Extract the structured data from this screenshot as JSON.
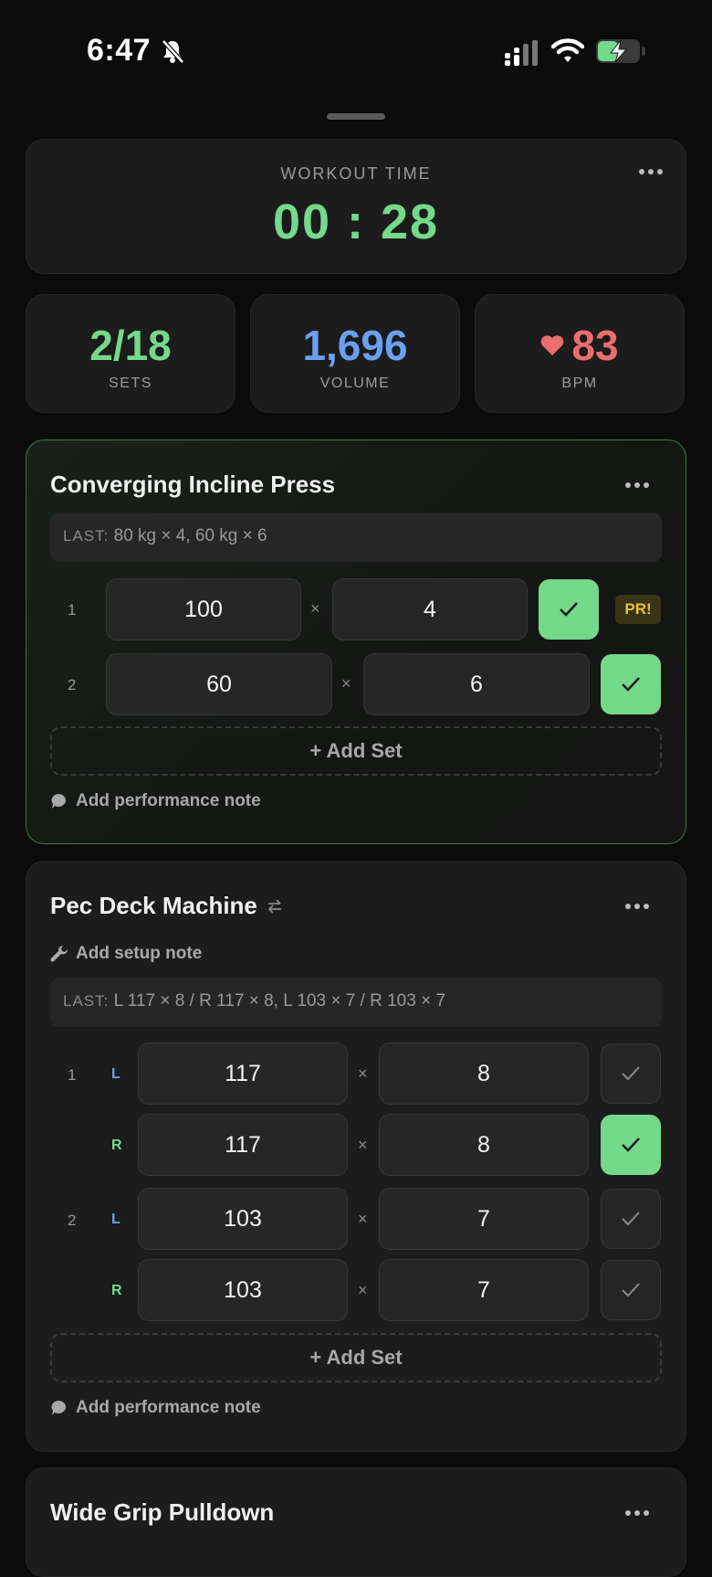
{
  "status_bar": {
    "time": "6:47"
  },
  "timer": {
    "label": "WORKOUT TIME",
    "value": "00 : 28"
  },
  "stats": {
    "sets": {
      "value": "2/18",
      "label": "SETS"
    },
    "volume": {
      "value": "1,696",
      "label": "VOLUME"
    },
    "bpm": {
      "value": "83",
      "label": "BPM"
    }
  },
  "colors": {
    "accent_green": "#74d98a",
    "volume_blue": "#6aa0f0",
    "bpm_red": "#ea6e6c",
    "pr_gold": "#e8c43a"
  },
  "exercises": [
    {
      "name": "Converging Incline Press",
      "last_label": "LAST:",
      "last_text": "80 kg × 4, 60 kg × 6",
      "sets": [
        {
          "num": "1",
          "weight": "100",
          "reps": "4",
          "done": true,
          "badge": "PR!"
        },
        {
          "num": "2",
          "weight": "60",
          "reps": "6",
          "done": true
        }
      ],
      "add_set": "+ Add Set",
      "note": "Add performance note"
    },
    {
      "name": "Pec Deck Machine",
      "setup_note": "Add setup note",
      "last_label": "LAST:",
      "last_text": "L 117 × 8 / R 117 × 8, L 103 × 7 / R 103 × 7",
      "sets": [
        {
          "num": "1",
          "side": "L",
          "weight": "117",
          "reps": "8",
          "done": false
        },
        {
          "num": "",
          "side": "R",
          "weight": "117",
          "reps": "8",
          "done": true
        },
        {
          "num": "2",
          "side": "L",
          "weight": "103",
          "reps": "7",
          "done": false
        },
        {
          "num": "",
          "side": "R",
          "weight": "103",
          "reps": "7",
          "done": false
        }
      ],
      "add_set": "+ Add Set",
      "note": "Add performance note"
    },
    {
      "name": "Wide Grip Pulldown"
    }
  ],
  "times_symbol": "×"
}
